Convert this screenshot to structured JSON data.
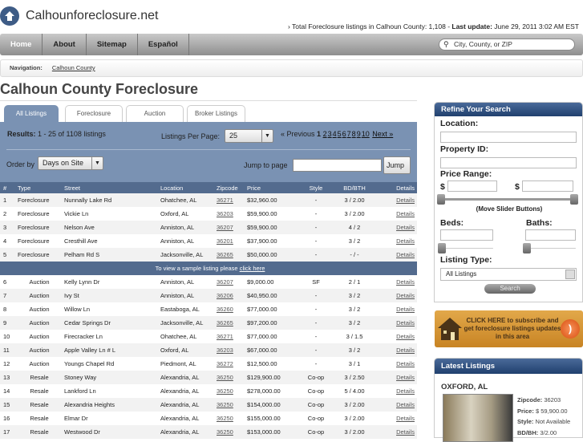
{
  "site": {
    "name": "Calhounforeclosure.net",
    "stats_prefix": "Total Foreclosure listings in Calhoun County: 1,108 - ",
    "last_update_label": "Last update:",
    "last_update": "June 29, 2011 3:02 AM EST"
  },
  "nav": {
    "items": [
      "Home",
      "About",
      "Sitemap",
      "Español"
    ],
    "search_placeholder": "City, County, or ZIP"
  },
  "breadcrumb": {
    "label": "Navigation:",
    "link": "Calhoun County"
  },
  "page_title": "Calhoun County Foreclosure",
  "tabs": [
    "All Listings",
    "Foreclosure",
    "Auction",
    "Broker Listings"
  ],
  "controls": {
    "results_label": "Results:",
    "results_text": "1 - 25 of 1108 listings",
    "per_page_label": "Listings Per Page:",
    "per_page": "25",
    "prev": "« Previous",
    "current_page": "1",
    "pages": [
      "2",
      "3",
      "4",
      "5",
      "6",
      "7",
      "8",
      "9",
      "10"
    ],
    "next": "Next »",
    "order_label": "Order by",
    "order_value": "Days on Site",
    "jump_label": "Jump to page",
    "jump_value": "",
    "jump_button": "Jump"
  },
  "table": {
    "headers": [
      "#",
      "Type",
      "Street",
      "Location",
      "Zipcode",
      "Price",
      "Style",
      "BD/BTH",
      "Details"
    ],
    "banner_text": "To view a sample listing please ",
    "banner_link": "click here",
    "rows": [
      [
        "1",
        "Foreclosure",
        "Nunnally Lake Rd",
        "Ohatchee, AL",
        "36271",
        "$32,960.00",
        "-",
        "3 / 2.00",
        "Details"
      ],
      [
        "2",
        "Foreclosure",
        "Vickie Ln",
        "Oxford, AL",
        "36203",
        "$59,900.00",
        "-",
        "3 / 2.00",
        "Details"
      ],
      [
        "3",
        "Foreclosure",
        "Nelson Ave",
        "Anniston, AL",
        "36207",
        "$59,900.00",
        "-",
        "4 / 2",
        "Details"
      ],
      [
        "4",
        "Foreclosure",
        "Cresthill Ave",
        "Anniston, AL",
        "36201",
        "$37,900.00",
        "-",
        "3 / 2",
        "Details"
      ],
      [
        "5",
        "Foreclosure",
        "Pelham Rd S",
        "Jacksonville, AL",
        "36265",
        "$50,000.00",
        "-",
        "- / -",
        "Details"
      ],
      [
        "6",
        "Auction",
        "Kelly Lynn Dr",
        "Anniston, AL",
        "36207",
        "$9,000.00",
        "SF",
        "2 / 1",
        "Details"
      ],
      [
        "7",
        "Auction",
        "Ivy St",
        "Anniston, AL",
        "36206",
        "$40,950.00",
        "-",
        "3 / 2",
        "Details"
      ],
      [
        "8",
        "Auction",
        "Willow Ln",
        "Eastaboga, AL",
        "36260",
        "$77,000.00",
        "-",
        "3 / 2",
        "Details"
      ],
      [
        "9",
        "Auction",
        "Cedar Springs Dr",
        "Jacksonville, AL",
        "36265",
        "$97,200.00",
        "-",
        "3 / 2",
        "Details"
      ],
      [
        "10",
        "Auction",
        "Firecracker Ln",
        "Ohatchee, AL",
        "36271",
        "$77,000.00",
        "-",
        "3 / 1.5",
        "Details"
      ],
      [
        "11",
        "Auction",
        "Apple Valley Ln # L",
        "Oxford, AL",
        "36203",
        "$67,000.00",
        "-",
        "3 / 2",
        "Details"
      ],
      [
        "12",
        "Auction",
        "Youngs Chapel Rd",
        "Piedmont, AL",
        "36272",
        "$12,500.00",
        "-",
        "3 / 1",
        "Details"
      ],
      [
        "13",
        "Resale",
        "Stoney Way",
        "Alexandria, AL",
        "36250",
        "$129,900.00",
        "Co-op",
        "3 / 2.50",
        "Details"
      ],
      [
        "14",
        "Resale",
        "Lankford Ln",
        "Alexandria, AL",
        "36250",
        "$278,000.00",
        "Co-op",
        "5 / 4.00",
        "Details"
      ],
      [
        "15",
        "Resale",
        "Alexandria Heights",
        "Alexandria, AL",
        "36250",
        "$154,000.00",
        "Co-op",
        "3 / 2.00",
        "Details"
      ],
      [
        "16",
        "Resale",
        "Elmar Dr",
        "Alexandria, AL",
        "36250",
        "$155,000.00",
        "Co-op",
        "3 / 2.00",
        "Details"
      ],
      [
        "17",
        "Resale",
        "Westwood Dr",
        "Alexandria, AL",
        "36250",
        "$153,000.00",
        "Co-op",
        "3 / 2.00",
        "Details"
      ]
    ]
  },
  "refine": {
    "title": "Refine Your Search",
    "location": "Location:",
    "property_id": "Property ID:",
    "price_range": "Price Range:",
    "currency": "$",
    "slider_hint": "(Move Slider Buttons)",
    "beds": "Beds:",
    "baths": "Baths:",
    "listing_type": "Listing Type:",
    "listing_type_value": "All Listings",
    "search_button": "Search"
  },
  "subscribe": {
    "text": "CLICK HERE to subscribe and get foreclosure listings updates in this area"
  },
  "latest": {
    "title": "Latest Listings",
    "city": "OXFORD, AL",
    "zip_label": "Zipcode:",
    "zip": "36203",
    "price_label": "Price:",
    "price": "$ 59,900.00",
    "style_label": "Style:",
    "style": "Not Available",
    "bdbh_label": "BD/BH:",
    "bdbh": "3/2.00"
  }
}
